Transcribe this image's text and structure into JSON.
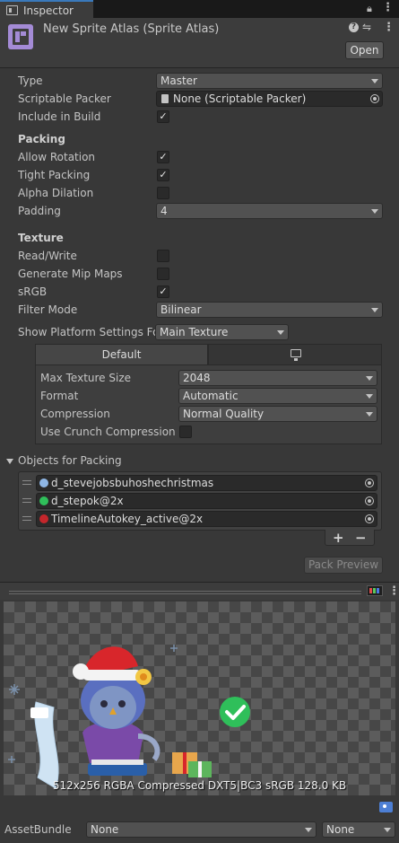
{
  "tab": {
    "title": "Inspector"
  },
  "asset": {
    "title": "New Sprite Atlas (Sprite Atlas)",
    "open_label": "Open"
  },
  "properties": {
    "type": {
      "label": "Type",
      "value": "Master"
    },
    "scriptable_packer": {
      "label": "Scriptable Packer",
      "value": "None (Scriptable Packer)"
    },
    "include_in_build": {
      "label": "Include in Build",
      "checked": true
    }
  },
  "packing": {
    "heading": "Packing",
    "allow_rotation": {
      "label": "Allow Rotation",
      "checked": true
    },
    "tight_packing": {
      "label": "Tight Packing",
      "checked": true
    },
    "alpha_dilation": {
      "label": "Alpha Dilation",
      "checked": false
    },
    "padding": {
      "label": "Padding",
      "value": "4"
    }
  },
  "texture": {
    "heading": "Texture",
    "read_write": {
      "label": "Read/Write",
      "checked": false
    },
    "generate_mip_maps": {
      "label": "Generate Mip Maps",
      "checked": false
    },
    "srgb": {
      "label": "sRGB",
      "checked": true
    },
    "filter_mode": {
      "label": "Filter Mode",
      "value": "Bilinear"
    }
  },
  "platform": {
    "label": "Show Platform Settings For",
    "value": "Main Texture",
    "tab_default": "Default",
    "max_texture_size": {
      "label": "Max Texture Size",
      "value": "2048"
    },
    "format": {
      "label": "Format",
      "value": "Automatic"
    },
    "compression": {
      "label": "Compression",
      "value": "Normal Quality"
    },
    "use_crunch": {
      "label": "Use Crunch Compression",
      "checked": false
    }
  },
  "objects": {
    "heading": "Objects for Packing",
    "items": [
      {
        "name": "d_stevejobsbuhoshechristmas",
        "icon": "sprite-icon",
        "color": "#8fb7e6"
      },
      {
        "name": "d_stepok@2x",
        "icon": "green-check-icon",
        "color": "#2fbf5a"
      },
      {
        "name": "TimelineAutokey_active@2x",
        "icon": "red-record-icon",
        "color": "#c4262b"
      }
    ],
    "add": "+",
    "remove": "−"
  },
  "pack_preview": "Pack Preview",
  "preview": {
    "caption": "512x256 RGBA Compressed DXT5|BC3 sRGB   128.0 KB"
  },
  "assetbundle": {
    "label": "AssetBundle",
    "name": "None",
    "variant": "None"
  },
  "colors": {
    "accent_tab": "#3a79bb",
    "badge": "#4d7fd4",
    "check_green": "#2fbf5a"
  }
}
